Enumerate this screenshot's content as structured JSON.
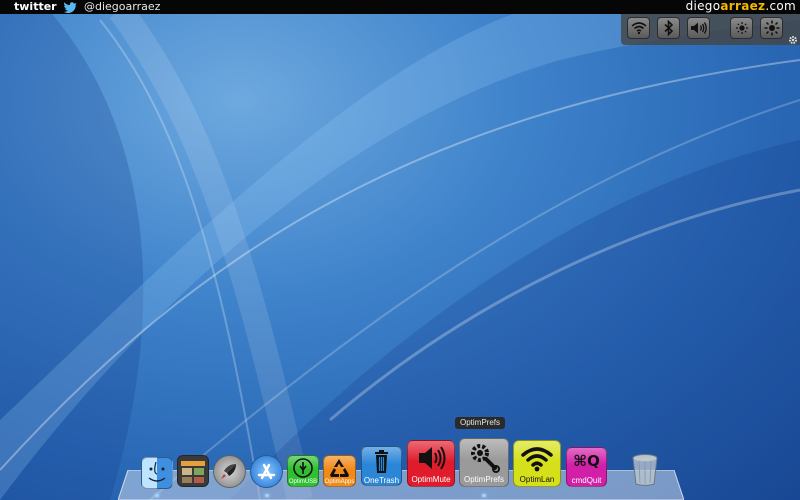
{
  "topbar": {
    "twitter_logo": "twitter",
    "handle": "@diegoarraez",
    "site_prefix": "diego",
    "site_highlight": "arraez",
    "site_suffix": ".com"
  },
  "control_panel": {
    "buttons": [
      {
        "name": "wifi-icon"
      },
      {
        "name": "bluetooth-icon"
      },
      {
        "name": "volume-icon"
      },
      {
        "name": "brightness-down-icon"
      },
      {
        "name": "brightness-up-icon"
      }
    ],
    "settings_icon": "gear-icon"
  },
  "tooltip": "OptimPrefs",
  "dock": {
    "items": [
      {
        "name": "Finder",
        "label": ""
      },
      {
        "name": "Photo Booth",
        "label": ""
      },
      {
        "name": "Launchpad",
        "label": ""
      },
      {
        "name": "App Store",
        "label": ""
      },
      {
        "name": "OptimUSB",
        "label": "OptimUSB",
        "color": "#2fbf2f"
      },
      {
        "name": "OptimApps",
        "label": "OptimApps",
        "color": "#f08a18"
      },
      {
        "name": "OneTrash",
        "label": "OneTrash",
        "color": "#2c86d8"
      },
      {
        "name": "OptimMute",
        "label": "OptimMute",
        "color": "#e01c2c"
      },
      {
        "name": "OptimPrefs",
        "label": "OptimPrefs",
        "color": "#9a9a9a"
      },
      {
        "name": "OptimLan",
        "label": "OptimLan",
        "color": "#d6e01a"
      },
      {
        "name": "cmdQuit",
        "label": "cmdQuit",
        "color": "#d21fa8"
      },
      {
        "name": "Trash",
        "label": ""
      }
    ],
    "cmdquit_glyph": "⌘Q"
  }
}
